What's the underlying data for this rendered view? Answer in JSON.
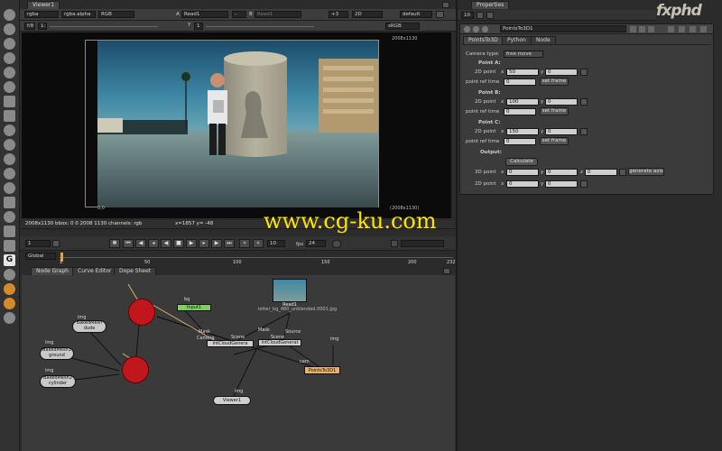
{
  "viewer_tab": "Viewer1",
  "viewer_toolbar": {
    "channels": "rgba",
    "alpha": "rgba.alpha",
    "colorspace": "RGB",
    "input_a_label": "A",
    "input_a": "Read1",
    "input_b_sep": "-",
    "input_b_label": "B",
    "input_b": "Read1",
    "gain": "+3",
    "view": "2D",
    "lut": "default",
    "proxy": "1:1",
    "fstop": "f/8",
    "frame": "1",
    "gamma_label": "Y",
    "gamma": "1",
    "lut2": "sRGB"
  },
  "viewer": {
    "format_top": "2008x1130",
    "format_bottom": "(2008x1130)",
    "corner_label": "0,0",
    "status_left": "2008x1130  bbox: 0 0 2008 1130 channels: rgb",
    "status_coords": "x=1857 y= -48"
  },
  "timeline": {
    "current_frame": "1",
    "step": "10",
    "fps_label": "fps",
    "fps": "24",
    "scope": "Global",
    "ticks": [
      "1",
      "50",
      "100",
      "150",
      "200",
      "232"
    ]
  },
  "bottom_tabs": [
    "Node Graph",
    "Curve Editor",
    "Dope Sheet"
  ],
  "properties": {
    "tab": "Properties",
    "count": "10",
    "node_name": "PointsTo3D1",
    "subtabs": [
      "PointsTo3D",
      "Python",
      "Node"
    ],
    "camera_type_label": "Camera type:",
    "camera_type": "free move",
    "points": [
      {
        "title": "Point A:",
        "x": "50",
        "y": "0",
        "ref": "0"
      },
      {
        "title": "Point B:",
        "x": "100",
        "y": "0",
        "ref": "0"
      },
      {
        "title": "Point C:",
        "x": "150",
        "y": "0",
        "ref": "0"
      }
    ],
    "point_2d_label": "2D point",
    "x_label": "x",
    "y_label": "y",
    "z_label": "z",
    "ref_time_label": "point ref time",
    "set_frame": "set frame",
    "output_label": "Output:",
    "calculate": "Calculate",
    "point_3d_label": "3D point",
    "out3d": {
      "x": "0",
      "y": "0",
      "z": "0"
    },
    "generate_axis": "generate axis",
    "out2d": {
      "x": "0",
      "y": "0"
    }
  },
  "nodes": {
    "n_img1": "img",
    "n_baked1": "BakedMesh\ndude",
    "n_img2": "img",
    "n_baked2": "BakedMesh1\nground",
    "n_img3": "img",
    "n_baked3": "BakedMesh2\ncylinder",
    "n_dot": "Input1",
    "n_read": "Read1",
    "n_read_file": "letter_bg_480_unblended.0001.jpg",
    "mask1": "Mask",
    "camera": "Camera",
    "scene1": "Scene",
    "mask2": "Mask",
    "scene2": "Scene",
    "source": "Source",
    "n_pc1": "intCloudGenera",
    "n_pc2": "intCloudGenerat",
    "img_pts": "img",
    "cam_lbl": "cam",
    "n_points": "PointsTo3D1",
    "img_viewer": "img",
    "n_viewer": "Viewer1",
    "bg": "bg"
  },
  "watermark": "www.cg-ku.com",
  "logo": "fxphd",
  "colors": {
    "accent_orange": "#e8b06a",
    "node_red": "#c0161e",
    "watermark": "#ffe400"
  }
}
